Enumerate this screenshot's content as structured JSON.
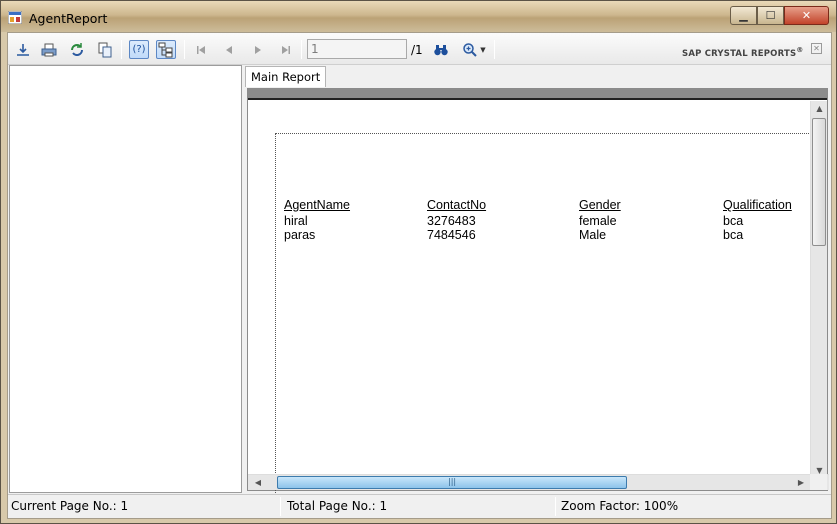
{
  "window": {
    "title": "AgentReport",
    "minimize": "▁",
    "maximize": "☐",
    "close": "✕"
  },
  "toolbar": {
    "export_icon": "export-icon",
    "print_icon": "print-icon",
    "refresh_icon": "refresh-icon",
    "copy_icon": "copy-icon",
    "help_icon": "help-icon",
    "help_label": "(?)",
    "group_tree_icon": "group-tree-icon",
    "first_page_icon": "first-page-icon",
    "prev_page_icon": "prev-page-icon",
    "next_page_icon": "next-page-icon",
    "last_page_icon": "last-page-icon",
    "page_number": "1",
    "page_total": "/1",
    "find_icon": "binoculars-icon",
    "zoom_icon": "zoom-icon",
    "brand": "SAP CRYSTAL REPORTS",
    "brand_mark": "®",
    "brand_close": "✕"
  },
  "tabs": [
    {
      "label": "Main Report"
    }
  ],
  "report": {
    "columns": [
      {
        "header": "AgentName",
        "values": [
          "hiral",
          "paras"
        ]
      },
      {
        "header": "ContactNo",
        "values": [
          "3276483",
          "7484546"
        ]
      },
      {
        "header": "Gender",
        "values": [
          "female",
          "Male"
        ]
      },
      {
        "header": "Qualification",
        "values": [
          "bca",
          "bca"
        ]
      }
    ]
  },
  "status": {
    "current_page": "Current Page No.: 1",
    "total_page": "Total Page No.: 1",
    "zoom": "Zoom Factor: 100%"
  },
  "colors": {
    "title_bar": "#cdb78e",
    "hscroll_thumb": "#8dc3ea",
    "close_button": "#c2432a"
  }
}
